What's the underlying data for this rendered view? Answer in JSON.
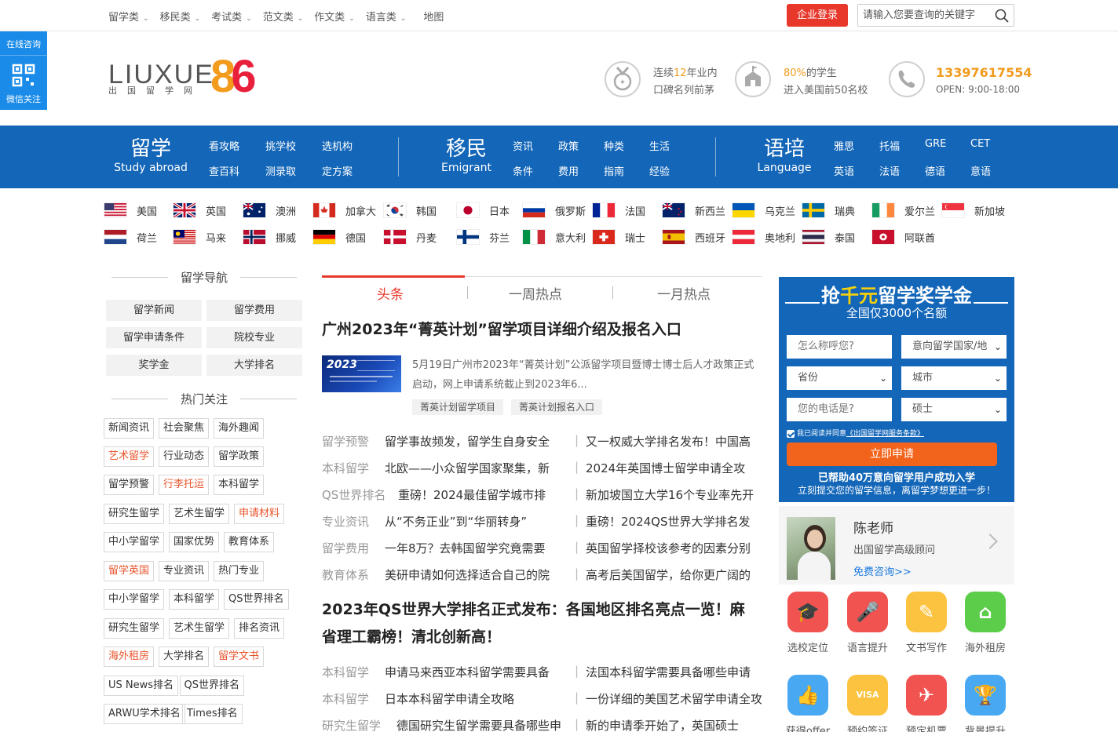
{
  "side": {
    "consult": "在线咨询",
    "wechat": "微信关注"
  },
  "topnav": {
    "items": [
      "留学类",
      "移民类",
      "考试类",
      "范文类",
      "作文类",
      "语言类"
    ],
    "map": "地图",
    "login": "企业登录",
    "search_placeholder": "请输入您要查询的关键字"
  },
  "logo": {
    "text": "LIUXUE",
    "num": "86",
    "sub": "出国留学网"
  },
  "header": {
    "h1a": "连续",
    "h1b": "12",
    "h1c": "年业内",
    "h1d": "口碑名列前茅",
    "h2a": "80%",
    "h2b": "的学生",
    "h2c": "进入美国前50名校",
    "phone": "13397617554",
    "open": "OPEN: 9:00-18:00"
  },
  "bluenav": {
    "study": {
      "cn": "留学",
      "en": "Study abroad",
      "links": [
        "看攻略",
        "挑学校",
        "选机构",
        "查百科",
        "测录取",
        "定方案"
      ]
    },
    "emigrant": {
      "cn": "移民",
      "en": "Emigrant",
      "links": [
        "资讯",
        "政策",
        "种类",
        "生活",
        "条件",
        "费用",
        "指南",
        "经验"
      ]
    },
    "language": {
      "cn": "语培",
      "en": "Language",
      "links": [
        "雅思",
        "托福",
        "GRE",
        "CET",
        "英语",
        "法语",
        "德语",
        "意语"
      ]
    }
  },
  "countries": [
    "美国",
    "英国",
    "澳洲",
    "加拿大",
    "韩国",
    "日本",
    "俄罗斯",
    "法国",
    "新西兰",
    "乌克兰",
    "瑞典",
    "爱尔兰",
    "新加坡",
    "荷兰",
    "马来",
    "挪威",
    "德国",
    "丹麦",
    "芬兰",
    "意大利",
    "瑞士",
    "西班牙",
    "奥地利",
    "泰国",
    "阿联酋"
  ],
  "left": {
    "nav_title": "留学导航",
    "nav": [
      "留学新闻",
      "留学费用",
      "留学申请条件",
      "院校专业",
      "奖学金",
      "大学排名"
    ],
    "hot_title": "热门关注",
    "tags": [
      [
        "新闻资讯",
        "社会聚焦",
        "海外趣闻"
      ],
      [
        "艺术留学",
        "行业动态",
        "留学政策"
      ],
      [
        "留学预警",
        "行李托运",
        "本科留学"
      ],
      [
        "研究生留学",
        "艺术生留学",
        "申请材料"
      ],
      [
        "中小学留学",
        "国家优势",
        "教育体系"
      ],
      [
        "留学英国",
        "专业资讯",
        "热门专业"
      ],
      [
        "中小学留学",
        "本科留学",
        "QS世界排名"
      ],
      [
        "研究生留学",
        "艺术生留学",
        "排名资讯"
      ],
      [
        "海外租房",
        "大学排名",
        "留学文书"
      ],
      [
        "US News排名",
        "QS世界排名"
      ],
      [
        "ARWU学术排名",
        "Times排名"
      ]
    ]
  },
  "middle": {
    "tabs": [
      "头条",
      "一周热点",
      "一月热点"
    ],
    "headline1": "广州2023年“菁英计划”留学项目详细介绍及报名入口",
    "thumb_year": "2023",
    "summary": "5月19日广州市2023年“菁英计划”公派留学项目暨博士博士后人才政策正式启动，网上申请系统截止到2023年6...",
    "stags": [
      "菁英计划留学项目",
      "菁英计划报名入口"
    ],
    "rows1": [
      [
        "留学预警",
        "留学事故频发，留学生自身安全",
        "又一权威大学排名发布！中国高"
      ],
      [
        "本科留学",
        "北欧——小众留学国家聚集，新",
        "2024年英国博士留学申请全攻"
      ],
      [
        "QS世界排名",
        "重磅！2024最佳留学城市排",
        "新加坡国立大学16个专业率先开"
      ],
      [
        "专业资讯",
        "从“不务正业”到“华丽转身”",
        "重磅！2024QS世界大学排名发"
      ],
      [
        "留学费用",
        "一年8万？去韩国留学究竟需要",
        "英国留学择校该参考的因素分别"
      ],
      [
        "教育体系",
        "美研申请如何选择适合自己的院",
        "高考后美国留学，给你更广阔的"
      ]
    ],
    "headline2a": "2023年QS世界大学排名正式发布：各国地区排名亮点一览！麻",
    "headline2b": "省理工霸榜！清北创新高！",
    "rows2": [
      [
        "本科留学",
        "申请马来西亚本科留学需要具备",
        "法国本科留学需要具备哪些申请"
      ],
      [
        "本科留学",
        "日本本科留学申请全攻略",
        "一份详细的美国艺术留学申请全攻略,"
      ],
      [
        "研究生留学",
        "德国研究生留学需要具备哪些申",
        "新的申请季开始了，英国硕士"
      ]
    ]
  },
  "form": {
    "title_a": "抢",
    "title_b": "千元",
    "title_c": "留学奖学金",
    "sub": "全国仅3000个名额",
    "name_ph": "怎么称呼您?",
    "country": "意向留学国家/地",
    "province": "省份",
    "city": "城市",
    "phone_ph": "您的电话是?",
    "degree": "硕士",
    "agree": "我已阅读并同意",
    "agree_link": "《出国留学网服务条款》",
    "submit": "立即申请",
    "bottom1": "已帮助40万意向留学用户成功入学",
    "bottom2": "立刻提交您的留学信息，离留学梦想更进一步！"
  },
  "advisor": {
    "name": "陈老师",
    "title": "出国留学高级顾问",
    "free": "免费咨询>>"
  },
  "services": [
    "选校定位",
    "语言提升",
    "文书写作",
    "海外租房",
    "获得offer",
    "预约签证",
    "预定机票",
    "背景提升"
  ],
  "colors": {
    "blue": "#1366b8",
    "red": "#e8382c",
    "orange": "#f29b1d",
    "side": "#1a8be8"
  }
}
